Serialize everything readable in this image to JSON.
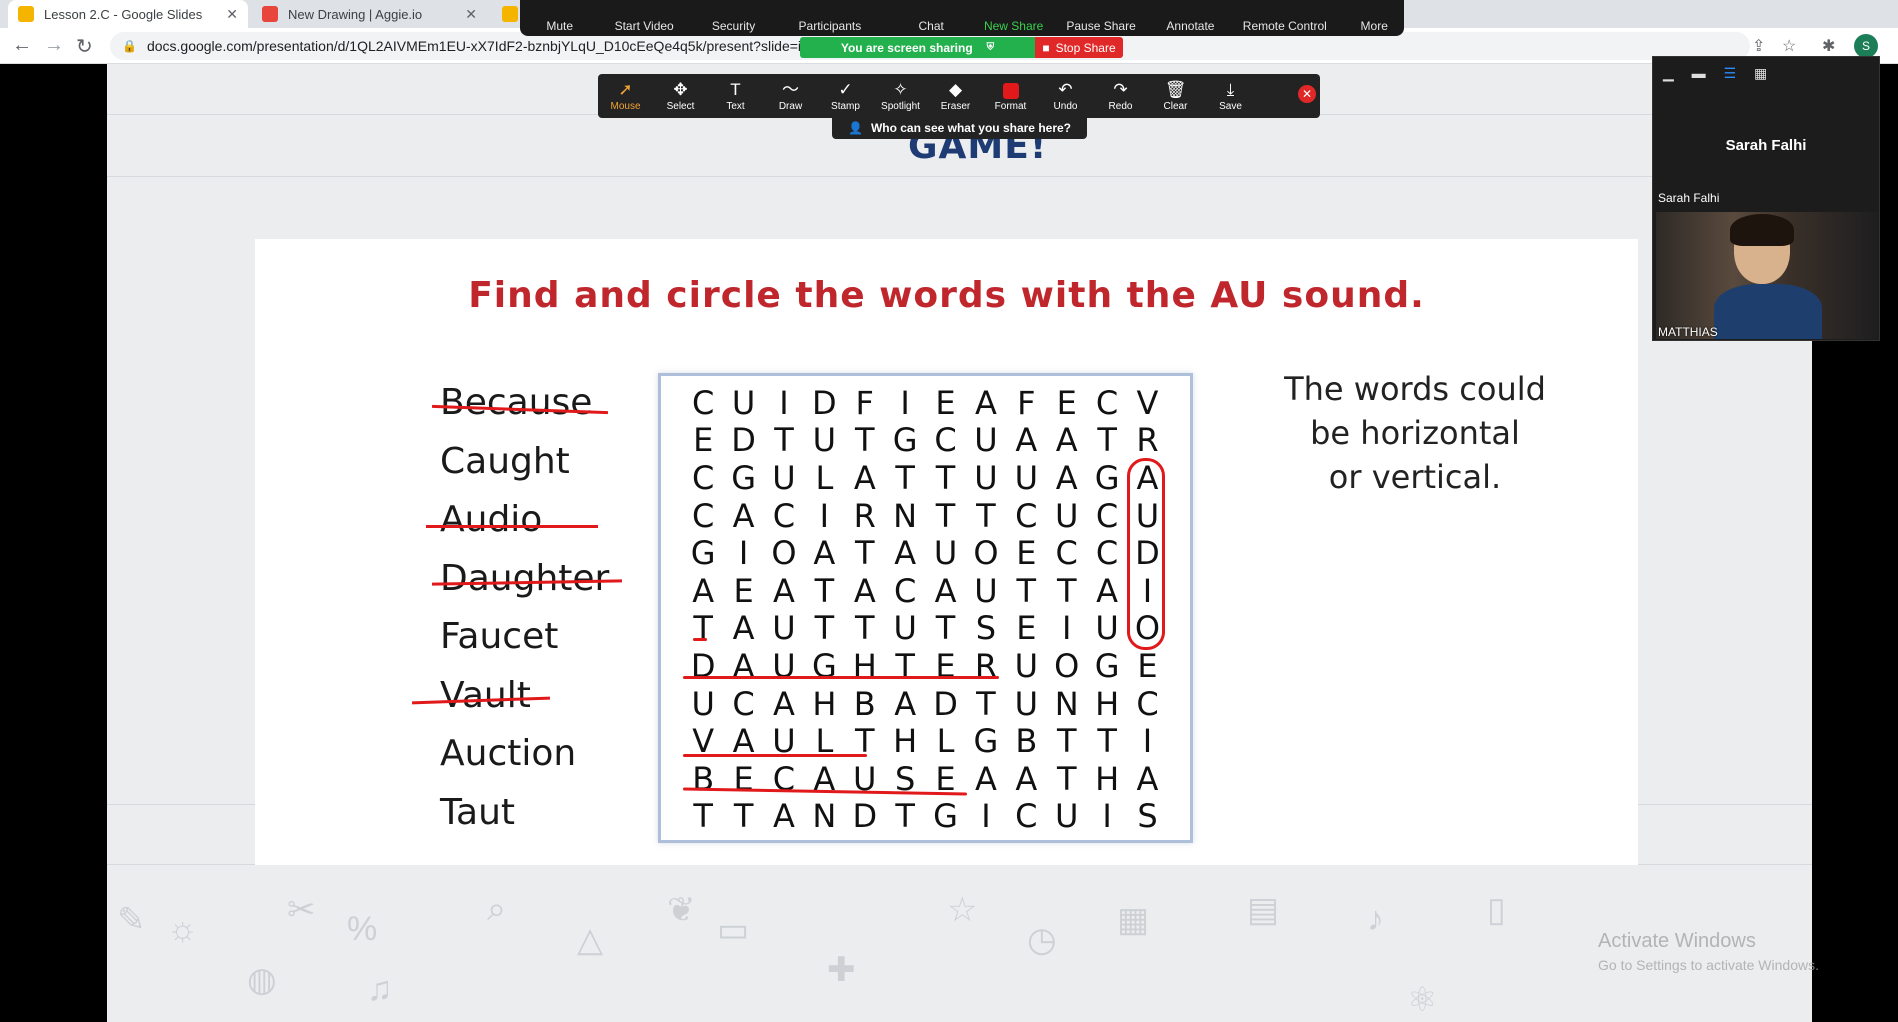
{
  "browser": {
    "tabs": [
      {
        "label": "Lesson 2.C - Google Slides",
        "active": true,
        "color": "#f4b400"
      },
      {
        "label": "New Drawing | Aggie.io",
        "active": false,
        "color": "#e8453c"
      }
    ],
    "url": "docs.google.com/presentation/d/1QL2AIVMEm1EU-xX7IdF2-bznbjYLqU_D10cEeQe4q5k/present?slide=id.g",
    "profile_initial": "S"
  },
  "zoom_toolbar": {
    "items": [
      "Mute",
      "Start Video",
      "Security",
      "Participants",
      "Chat",
      "New Share",
      "Pause Share",
      "Annotate",
      "Remote Control",
      "More"
    ],
    "banner": "You are screen sharing",
    "stop_label": "Stop Share"
  },
  "annotate_toolbar": {
    "tools": [
      {
        "label": "Mouse",
        "icon": "cursor-icon",
        "active": true
      },
      {
        "label": "Select",
        "icon": "move-icon"
      },
      {
        "label": "Text",
        "icon": "text-icon"
      },
      {
        "label": "Draw",
        "icon": "draw-icon"
      },
      {
        "label": "Stamp",
        "icon": "stamp-icon"
      },
      {
        "label": "Spotlight",
        "icon": "spotlight-icon"
      },
      {
        "label": "Eraser",
        "icon": "eraser-icon"
      },
      {
        "label": "Format",
        "icon": "format-icon"
      },
      {
        "label": "Undo",
        "icon": "undo-icon"
      },
      {
        "label": "Redo",
        "icon": "redo-icon"
      },
      {
        "label": "Clear",
        "icon": "trash-icon"
      },
      {
        "label": "Save",
        "icon": "save-icon"
      }
    ],
    "who_can_see": "Who can see what you share here?"
  },
  "slide": {
    "title_fragment": "GAME!",
    "instruction": "Find and circle the words with the AU sound.",
    "words": [
      {
        "text": "Because",
        "struck": true
      },
      {
        "text": "Caught",
        "struck": false
      },
      {
        "text": "Audio",
        "struck": true
      },
      {
        "text": "Daughter",
        "struck": true
      },
      {
        "text": "Faucet",
        "struck": false
      },
      {
        "text": "Vault",
        "struck": true
      },
      {
        "text": "Auction",
        "struck": false
      },
      {
        "text": "Taut",
        "struck": false
      }
    ],
    "grid": [
      "CUIDFIEAFECV",
      "EDTUTGCUAATR",
      "CGULATTUUAGA",
      "CACIRNTTCUCU",
      "GIOATAUOECCD",
      "AEATACAUTTAI",
      "TAUTTUTSEIUO",
      "DAUGHTERUOGE",
      "UCAHBADTUNHC",
      "VAULTHLGBTTI",
      "BECAUSEAATHA",
      "TTANDTGICUIS"
    ],
    "side_note": [
      "The words could",
      "be horizontal",
      "or vertical."
    ],
    "annotation_color": "#e1191b"
  },
  "watermark": {
    "line1": "Activate Windows",
    "line2": "Go to Settings to activate Windows."
  },
  "participant_panel": {
    "name_big": "Sarah Falhi",
    "name_small": "Sarah Falhi",
    "video_label": "MATTHIAS"
  }
}
